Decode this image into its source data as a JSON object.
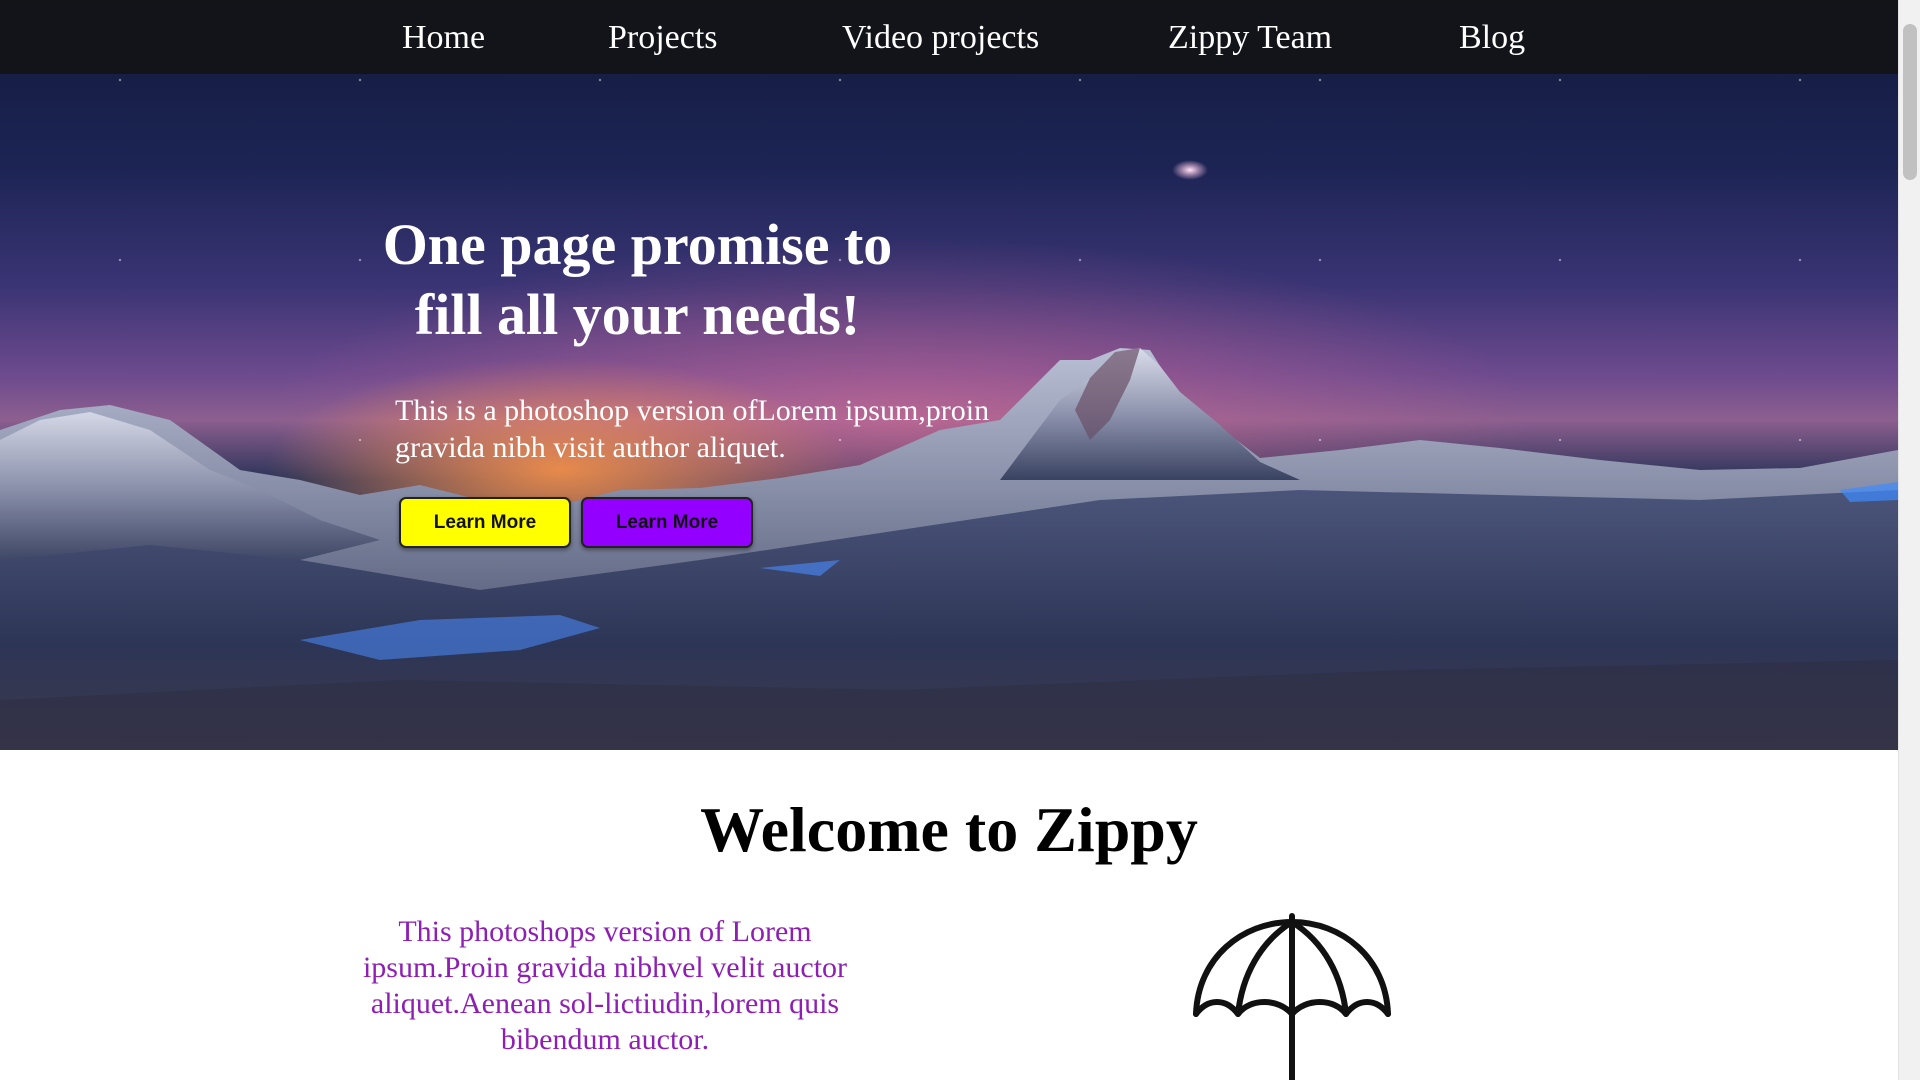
{
  "nav": {
    "items": [
      {
        "label": "Home"
      },
      {
        "label": "Projects"
      },
      {
        "label": "Video projects"
      },
      {
        "label": "Zippy Team"
      },
      {
        "label": "Blog"
      }
    ]
  },
  "hero": {
    "title": "One page promise to fill all your needs!",
    "subtitle": "This is a photoshop version ofLorem ipsum,proin gravida nibh visit author aliquet.",
    "buttons": [
      {
        "label": "Learn More",
        "color": "#ffff00"
      },
      {
        "label": "Learn More",
        "color": "#9400ff"
      }
    ]
  },
  "welcome": {
    "title": "Welcome to Zippy",
    "text": "This photoshops version of Lorem ipsum.Proin gravida nibhvel velit auctor aliquet.Aenean sol-lictiudin,lorem quis bibendum auctor.",
    "text_color": "#8e1fb3",
    "icon": "umbrella-icon"
  }
}
